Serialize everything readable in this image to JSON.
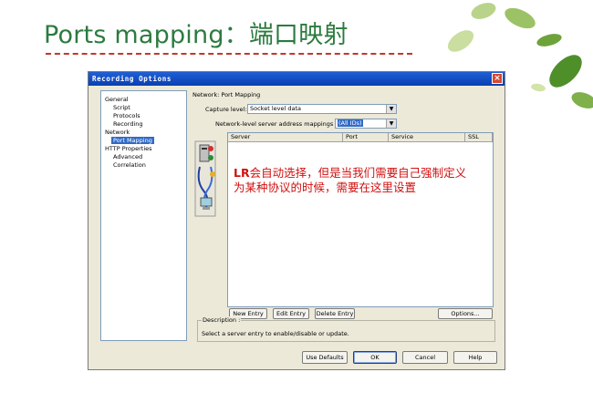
{
  "slide": {
    "title": "Ports mapping：端口映射",
    "annotation_line1_strong": "LR",
    "annotation_line1_rest": "会自动选择，但是当我们需要自己强制定义",
    "annotation_line2": "为某种协议的时候，需要在这里设置",
    "annotation_color": "#d01010",
    "title_color": "#2d7a40"
  },
  "dialog": {
    "title": "Recording Options",
    "close_label": "×",
    "tree": [
      {
        "label": "General"
      },
      {
        "label": "Script"
      },
      {
        "label": "Protocols"
      },
      {
        "label": "Recording"
      },
      {
        "label": "Network"
      },
      {
        "label": "Port Mapping",
        "selected": true
      },
      {
        "label": "HTTP Properties"
      },
      {
        "label": "Advanced"
      },
      {
        "label": "Correlation"
      }
    ],
    "section_label": "Network: Port Mapping",
    "capture_level_label": "Capture level:",
    "capture_level_value": "Socket level data",
    "mappings_label": "Network-level server address mappings for :",
    "mappings_value": "(All IDs)",
    "columns": [
      "Server",
      "Port",
      "Service",
      "SSL"
    ],
    "buttons": {
      "new_entry": "New Entry",
      "edit_entry": "Edit Entry",
      "delete_entry": "Delete Entry",
      "options": "Options..."
    },
    "description_label": "Description :",
    "description_text": "Select a server entry to enable/disable or update.",
    "footer": {
      "use_defaults": "Use Defaults",
      "ok": "OK",
      "cancel": "Cancel",
      "help": "Help"
    }
  }
}
